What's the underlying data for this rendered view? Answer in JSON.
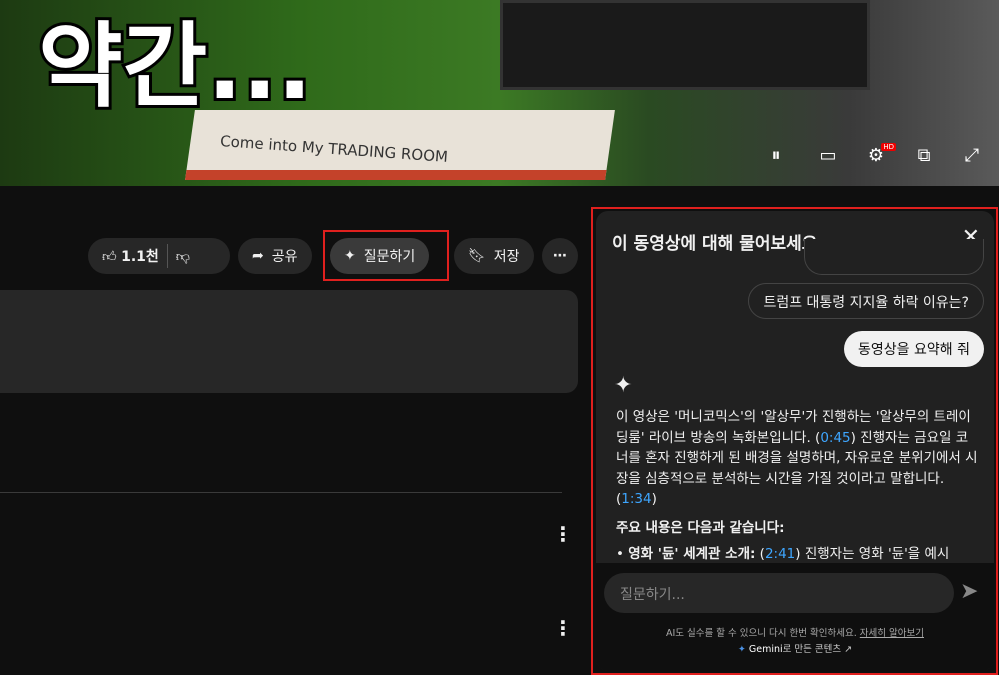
{
  "video": {
    "overlay_text": "약간...",
    "book_title": "Come into My TRADING ROOM",
    "hd_badge": "HD"
  },
  "actions": {
    "like_count": "1.1천",
    "share": "공유",
    "ask": "질문하기",
    "save": "저장"
  },
  "panel": {
    "title": "이 동영상에 대해 물어보세요",
    "suggestions": [
      "트럼프 대통령 지지율 하락 이유는?"
    ],
    "user_message": "동영상을 요약해 줘",
    "response": {
      "p1a": "이 영상은 '머니코믹스'의 '알상무'가 진행하는 '알상무의 트레이딩룸' 라이브 방송의 녹화본입니다. (",
      "ts1": "0:45",
      "p1b": ") 진행자는 금요일 코너를 혼자 진행하게 된 배경을 설명하며, 자유로운 분위기에서 시장을 심층적으로 분석하는 시간을 가질 것이라고 말합니다. (",
      "ts2": "1:34",
      "p1c": ")",
      "heading": "주요 내용은 다음과 같습니다:",
      "bullet_bold": "영화 '듄' 세계관 소개:",
      "bullet_pre": " (",
      "ts3": "2:41",
      "bullet_text": ") 진행자는 영화 '듄'을 예시"
    },
    "input_placeholder": "질문하기...",
    "disclaimer": "AI도 실수를 할 수 있으니 다시 한번 확인하세요.",
    "learn_more": "자세히 알아보기",
    "gemini": "Gemini",
    "gemini_suffix": "로 만든 콘텐츠"
  }
}
